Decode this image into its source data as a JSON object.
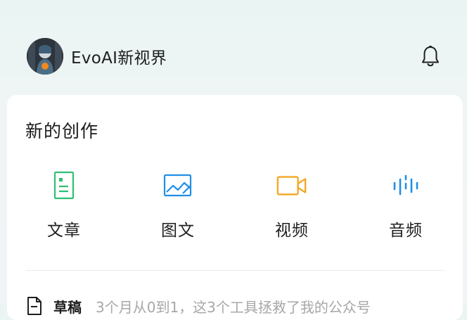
{
  "header": {
    "account_name": "EvoAI新视界",
    "avatar_icon": "user-avatar",
    "bell_icon": "bell-icon"
  },
  "create": {
    "title": "新的创作",
    "options": [
      {
        "label": "文章",
        "icon": "article-icon",
        "color": "#2fbf71"
      },
      {
        "label": "图文",
        "icon": "image-text-icon",
        "color": "#1f8fe8"
      },
      {
        "label": "视频",
        "icon": "video-icon",
        "color": "#f5a623"
      },
      {
        "label": "音频",
        "icon": "audio-icon",
        "color": "#1f8fe8"
      }
    ]
  },
  "drafts": {
    "label": "草稿",
    "preview": "3个月从0到1，这3个工具拯救了我的公众号",
    "icon": "document-icon"
  }
}
